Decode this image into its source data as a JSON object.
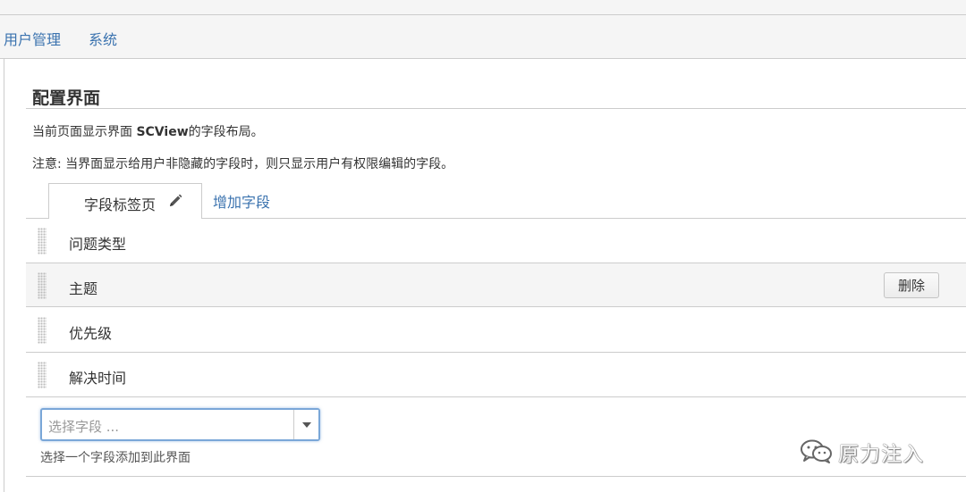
{
  "nav": {
    "items": [
      {
        "label": "用户管理"
      },
      {
        "label": "系统"
      }
    ]
  },
  "page": {
    "title": "配置界面",
    "desc1": {
      "before": "当前页面显示界面 ",
      "screen_name": "SCView",
      "after": "的字段布局。"
    },
    "desc2": "注意: 当界面显示给用户非隐藏的字段时，则只显示用户有权限编辑的字段。"
  },
  "tabs": {
    "active_label": "字段标签页",
    "active_icon": "pencil-icon",
    "add_label": "增加字段"
  },
  "fields": [
    {
      "label": "问题类型"
    },
    {
      "label": "主题",
      "delete_label": "删除"
    },
    {
      "label": "优先级"
    },
    {
      "label": "解决时间"
    }
  ],
  "field_select": {
    "placeholder": "选择字段 ...",
    "help": "选择一个字段添加到此界面"
  },
  "watermark": {
    "text": "原力注入",
    "icon": "wechat-icon"
  },
  "colors": {
    "link": "#3b73af",
    "border": "#cccccc",
    "focus": "#7aa7d8",
    "highlight_row": "#f5f5f5"
  }
}
